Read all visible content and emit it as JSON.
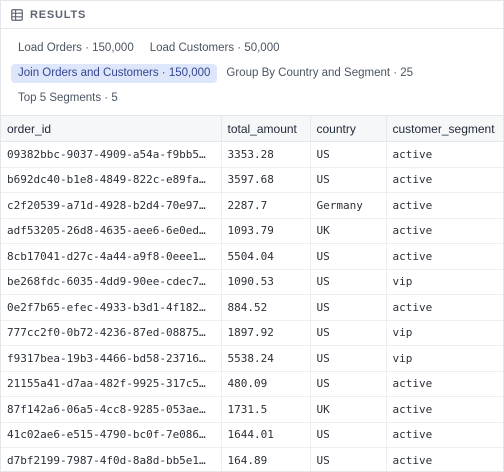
{
  "header": {
    "title": "RESULTS",
    "icon": "table-icon"
  },
  "chips": [
    {
      "label": "Load Orders · 150,000",
      "active": false
    },
    {
      "label": "Load Customers · 50,000",
      "active": false
    },
    {
      "label": "Join Orders and Customers · 150,000",
      "active": true
    },
    {
      "label": "Group By Country and Segment · 25",
      "active": false
    },
    {
      "label": "Top 5 Segments · 5",
      "active": false
    }
  ],
  "table": {
    "columns": [
      "order_id",
      "total_amount",
      "country",
      "customer_segment"
    ],
    "rows": [
      [
        "09382bbc-9037-4909-a54a-f9bb5…",
        "3353.28",
        "US",
        "active"
      ],
      [
        "b692dc40-b1e8-4849-822c-e89fa…",
        "3597.68",
        "US",
        "active"
      ],
      [
        "c2f20539-a71d-4928-b2d4-70e97…",
        "2287.7",
        "Germany",
        "active"
      ],
      [
        "adf53205-26d8-4635-aee6-6e0ed…",
        "1093.79",
        "UK",
        "active"
      ],
      [
        "8cb17041-d27c-4a44-a9f8-0eee1…",
        "5504.04",
        "US",
        "active"
      ],
      [
        "be268fdc-6035-4dd9-90ee-cdec7…",
        "1090.53",
        "US",
        "vip"
      ],
      [
        "0e2f7b65-efec-4933-b3d1-4f182…",
        "884.52",
        "US",
        "active"
      ],
      [
        "777cc2f0-0b72-4236-87ed-08875…",
        "1897.92",
        "US",
        "vip"
      ],
      [
        "f9317bea-19b3-4466-bd58-23716…",
        "5538.24",
        "US",
        "vip"
      ],
      [
        "21155a41-d7aa-482f-9925-317c5…",
        "480.09",
        "US",
        "active"
      ],
      [
        "87f142a6-06a5-4cc8-9285-053ae…",
        "1731.5",
        "UK",
        "active"
      ],
      [
        "41c02ae6-e515-4790-bc0f-7e086…",
        "1644.01",
        "US",
        "active"
      ],
      [
        "d7bf2199-7987-4f0d-8a8d-bb5e1…",
        "164.89",
        "US",
        "active"
      ]
    ]
  }
}
